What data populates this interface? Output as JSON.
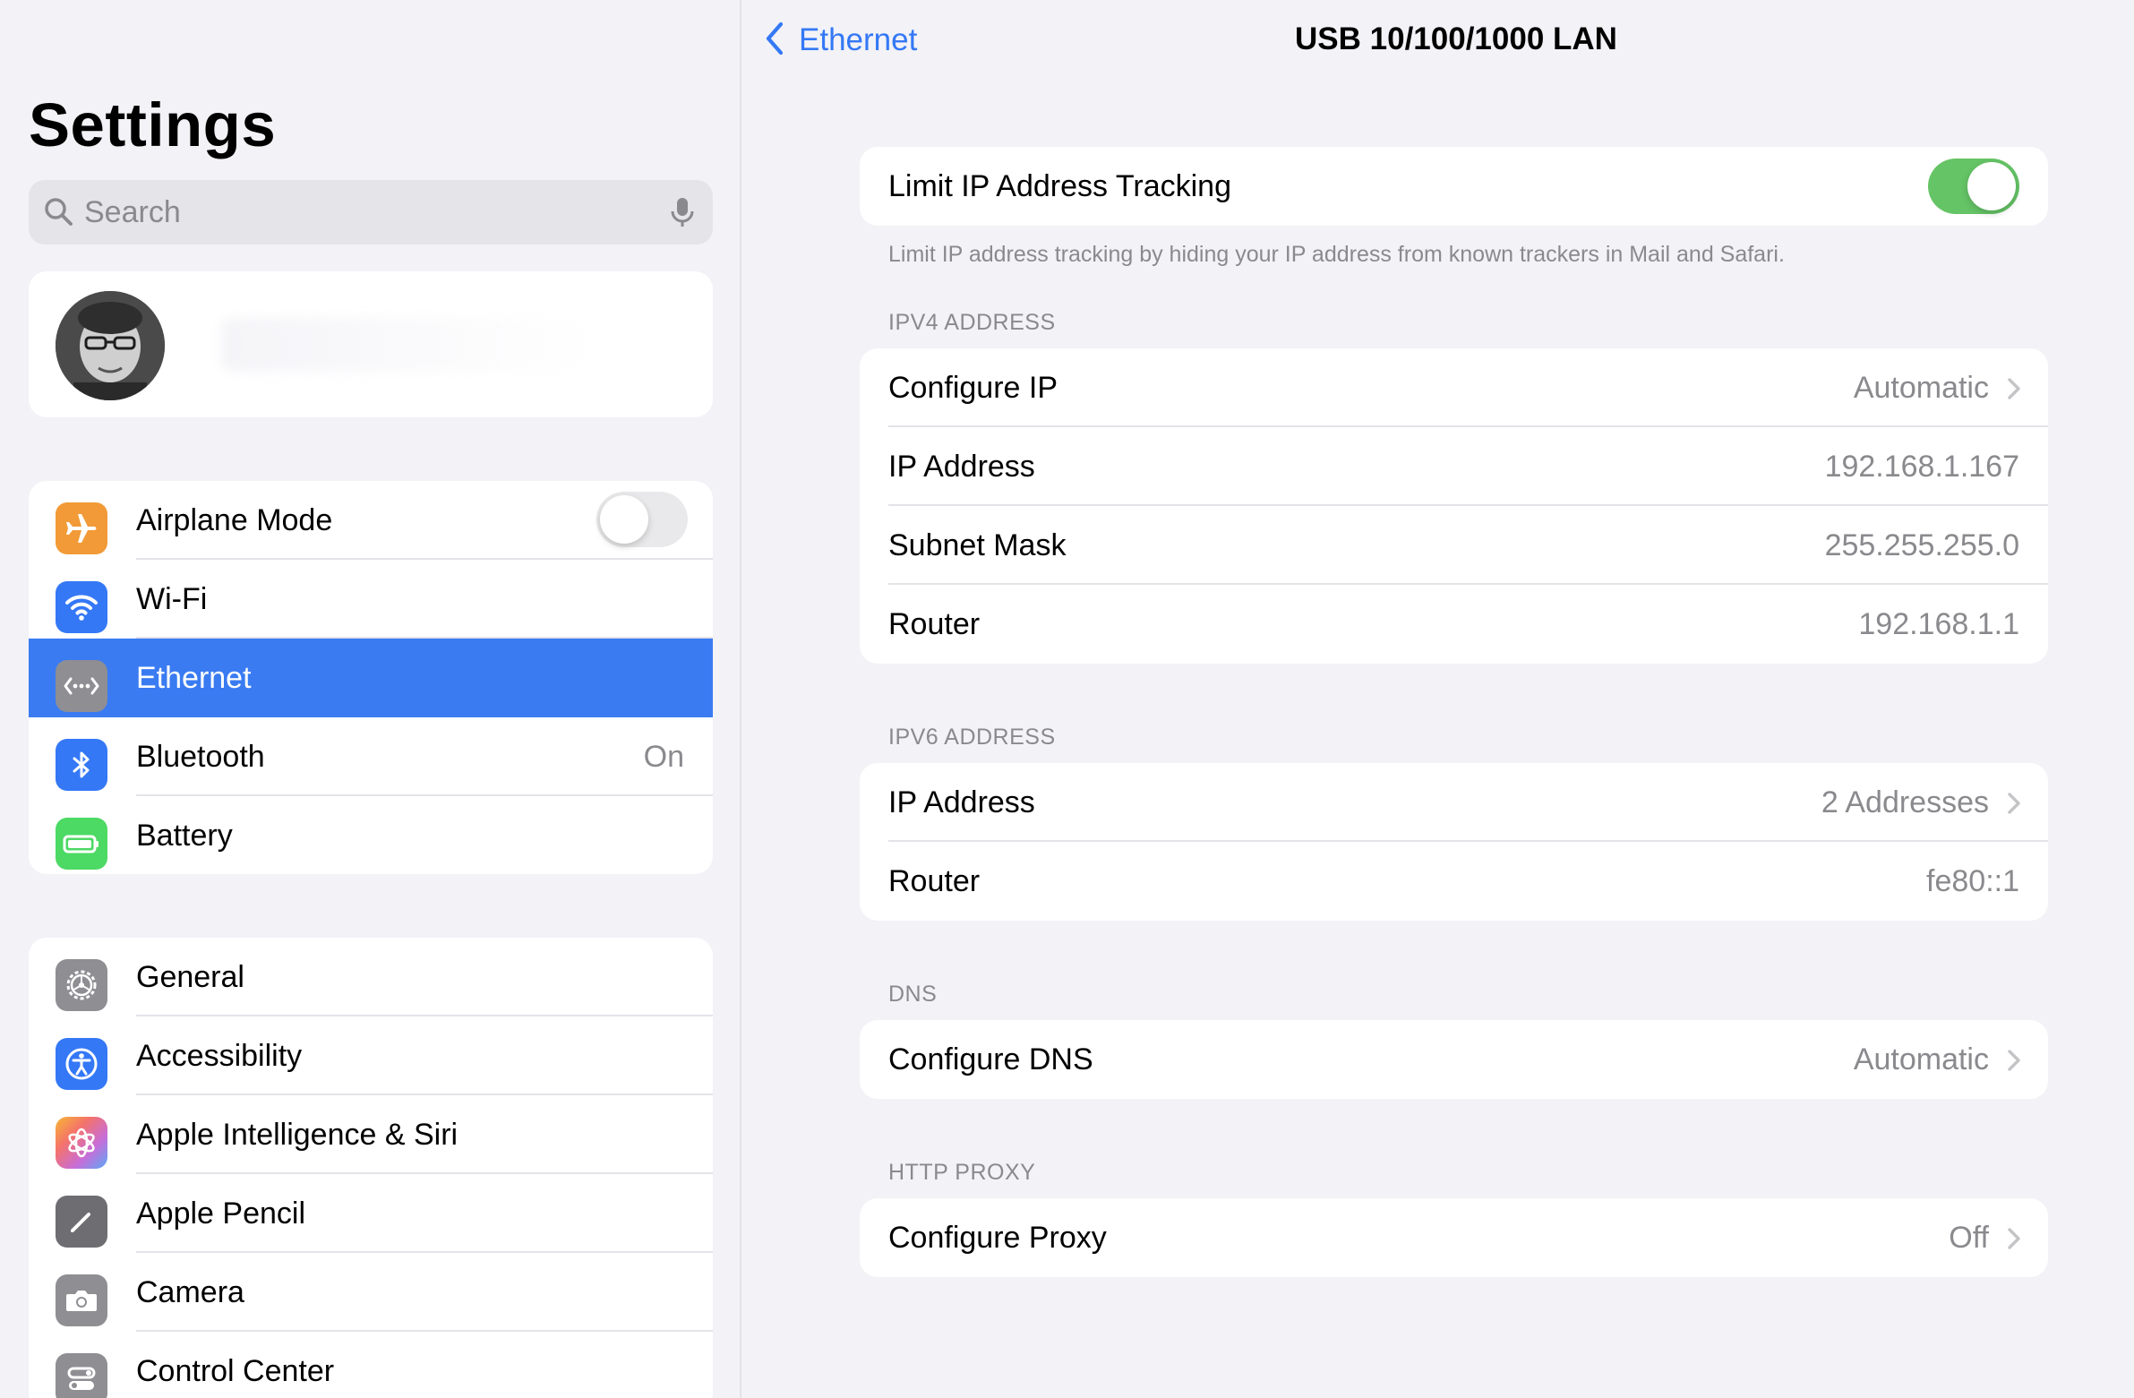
{
  "sidebar": {
    "title": "Settings",
    "search_placeholder": "Search",
    "connectivity": [
      {
        "label": "Airplane Mode",
        "value": "",
        "icon": "airplane-icon",
        "color": "#f19a37",
        "toggle": "off"
      },
      {
        "label": "Wi-Fi",
        "value": "",
        "icon": "wifi-icon",
        "color": "#3478f6"
      },
      {
        "label": "Ethernet",
        "value": "",
        "icon": "ethernet-icon",
        "color": "#8e8e93",
        "selected": true
      },
      {
        "label": "Bluetooth",
        "value": "On",
        "icon": "bluetooth-icon",
        "color": "#3478f6"
      },
      {
        "label": "Battery",
        "value": "",
        "icon": "battery-icon",
        "color": "#4cd964"
      }
    ],
    "system": [
      {
        "label": "General",
        "icon": "gear-icon",
        "color": "#8e8e93"
      },
      {
        "label": "Accessibility",
        "icon": "accessibility-icon",
        "color": "#3478f6"
      },
      {
        "label": "Apple Intelligence & Siri",
        "icon": "apple-intelligence-icon",
        "color": "#f4736a"
      },
      {
        "label": "Apple Pencil",
        "icon": "pencil-icon",
        "color": "#6d6d72"
      },
      {
        "label": "Camera",
        "icon": "camera-icon",
        "color": "#8e8e93"
      },
      {
        "label": "Control Center",
        "icon": "control-center-icon",
        "color": "#8e8e93"
      }
    ]
  },
  "detail": {
    "back_label": "Ethernet",
    "title": "USB 10/100/1000 LAN",
    "tracking": {
      "label": "Limit IP Address Tracking",
      "toggle": "on",
      "footer": "Limit IP address tracking by hiding your IP address from known trackers in Mail and Safari."
    },
    "ipv4": {
      "header": "IPV4 ADDRESS",
      "rows": [
        {
          "label": "Configure IP",
          "value": "Automatic",
          "chevron": true
        },
        {
          "label": "IP Address",
          "value": "192.168.1.167"
        },
        {
          "label": "Subnet Mask",
          "value": "255.255.255.0"
        },
        {
          "label": "Router",
          "value": "192.168.1.1"
        }
      ]
    },
    "ipv6": {
      "header": "IPV6 ADDRESS",
      "rows": [
        {
          "label": "IP Address",
          "value": "2 Addresses",
          "chevron": true
        },
        {
          "label": "Router",
          "value": "fe80::1"
        }
      ]
    },
    "dns": {
      "header": "DNS",
      "rows": [
        {
          "label": "Configure DNS",
          "value": "Automatic",
          "chevron": true
        }
      ]
    },
    "proxy": {
      "header": "HTTP PROXY",
      "rows": [
        {
          "label": "Configure Proxy",
          "value": "Off",
          "chevron": true
        }
      ]
    }
  },
  "colors": {
    "accent": "#3478f6",
    "selected_row": "#3a7bf2",
    "toggle_on": "#65c466",
    "background": "#f2f2f7",
    "secondary_text": "#8a8a8e"
  }
}
